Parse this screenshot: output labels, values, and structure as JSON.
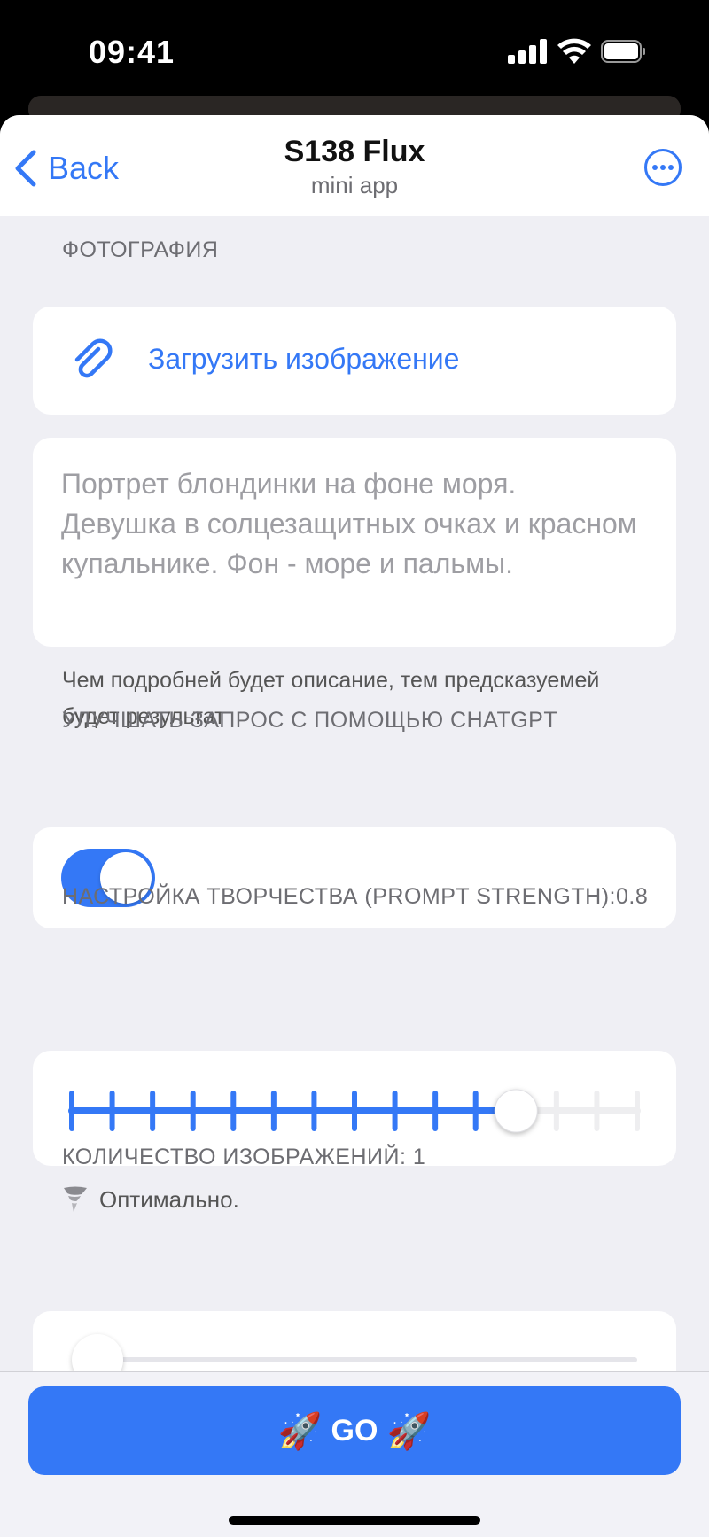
{
  "status_bar": {
    "time": "09:41"
  },
  "nav": {
    "back_label": "Back",
    "title": "S138 Flux",
    "subtitle": "mini app",
    "more_icon": "more-circle-icon",
    "accent": "#3478f6"
  },
  "photo_section": {
    "header": "ФОТОГРАФИЯ",
    "upload_label": "Загрузить изображение",
    "upload_icon": "paperclip-icon"
  },
  "prompt": {
    "placeholder": "Портрет блондинки на фоне моря. Девушка в солцезащитных очках и красном купальнике. Фон - море и пальмы.",
    "hint": "Чем подробней будет описание, тем предсказуемей будет результат"
  },
  "chatgpt_section": {
    "header": "УЛУЧШАТЬ ЗАПРОС С ПОМОЩЬЮ CHATGPT",
    "toggle_on": true
  },
  "strength_section": {
    "header": "НАСТРОЙКА ТВОРЧЕСТВА (PROMPT STRENGTH):0.8",
    "value": 0.8,
    "ticks": 15,
    "selected_step": 11,
    "status_icon": "tornado-icon",
    "status_text": "Оптимально."
  },
  "count_section": {
    "header": "КОЛИЧЕСТВО ИЗОБРАЖЕНИЙ: 1",
    "value": 1
  },
  "go_button": {
    "label": "GO",
    "icon": "rocket-icon",
    "rocket": "🚀",
    "color": "#3478f6"
  }
}
